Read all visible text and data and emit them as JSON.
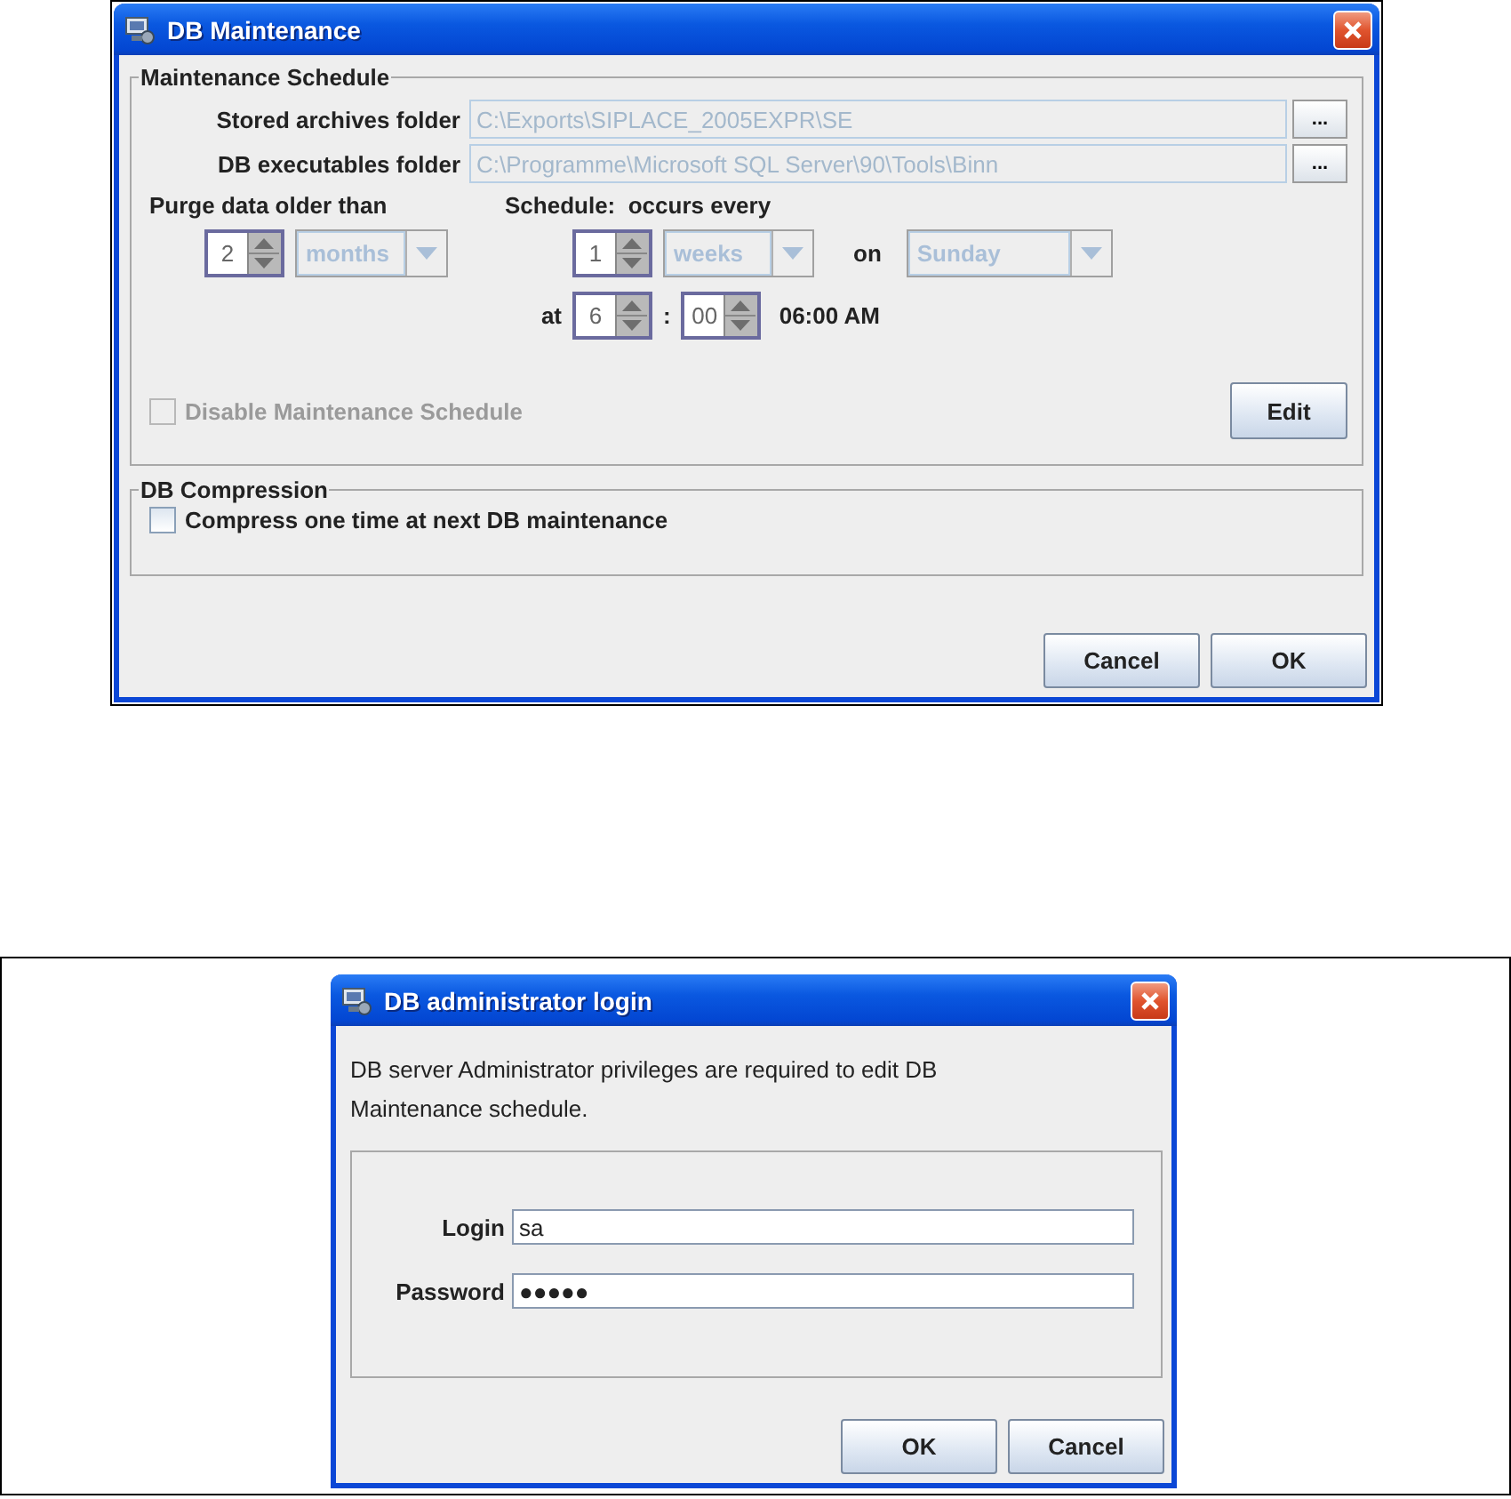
{
  "maintenance_dialog": {
    "title": "DB Maintenance",
    "schedule_group": {
      "title": "Maintenance Schedule",
      "folders": [
        {
          "label": "Stored archives folder",
          "value": "C:\\Exports\\SIPLACE_2005EXPR\\SE",
          "disabled": true,
          "browse": "..."
        },
        {
          "label": "DB executables folder",
          "value": "C:\\Programme\\Microsoft SQL Server\\90\\Tools\\Binn",
          "disabled": true,
          "browse": "..."
        }
      ],
      "purge": {
        "label": "Purge data older than",
        "amount": "2",
        "unit": {
          "value": "months",
          "disabled": true
        }
      },
      "schedule": {
        "label": "Schedule:  occurs every",
        "amount": "1",
        "unit": {
          "value": "weeks",
          "disabled": true
        },
        "on_label": "on",
        "day": {
          "value": "Sunday",
          "disabled": true
        },
        "at_label": "at",
        "hour": "6",
        "separator": ":",
        "minute": "00",
        "time_text": "06:00 AM"
      },
      "disable_checkbox": {
        "label": "Disable Maintenance Schedule",
        "checked": false,
        "disabled": true
      },
      "edit_button": "Edit"
    },
    "compression_group": {
      "title": "DB Compression",
      "checkbox": {
        "label": "Compress one time at next DB maintenance",
        "checked": false,
        "disabled": false
      }
    },
    "buttons": [
      "Cancel",
      "OK"
    ]
  },
  "login_dialog": {
    "title": "DB administrator login",
    "message": "DB server Administrator privileges are required to edit DB Maintenance schedule.",
    "fields": [
      {
        "label": "Login",
        "value": "sa"
      },
      {
        "label": "Password",
        "value": "●●●●●"
      }
    ],
    "buttons": [
      "OK",
      "Cancel"
    ]
  }
}
